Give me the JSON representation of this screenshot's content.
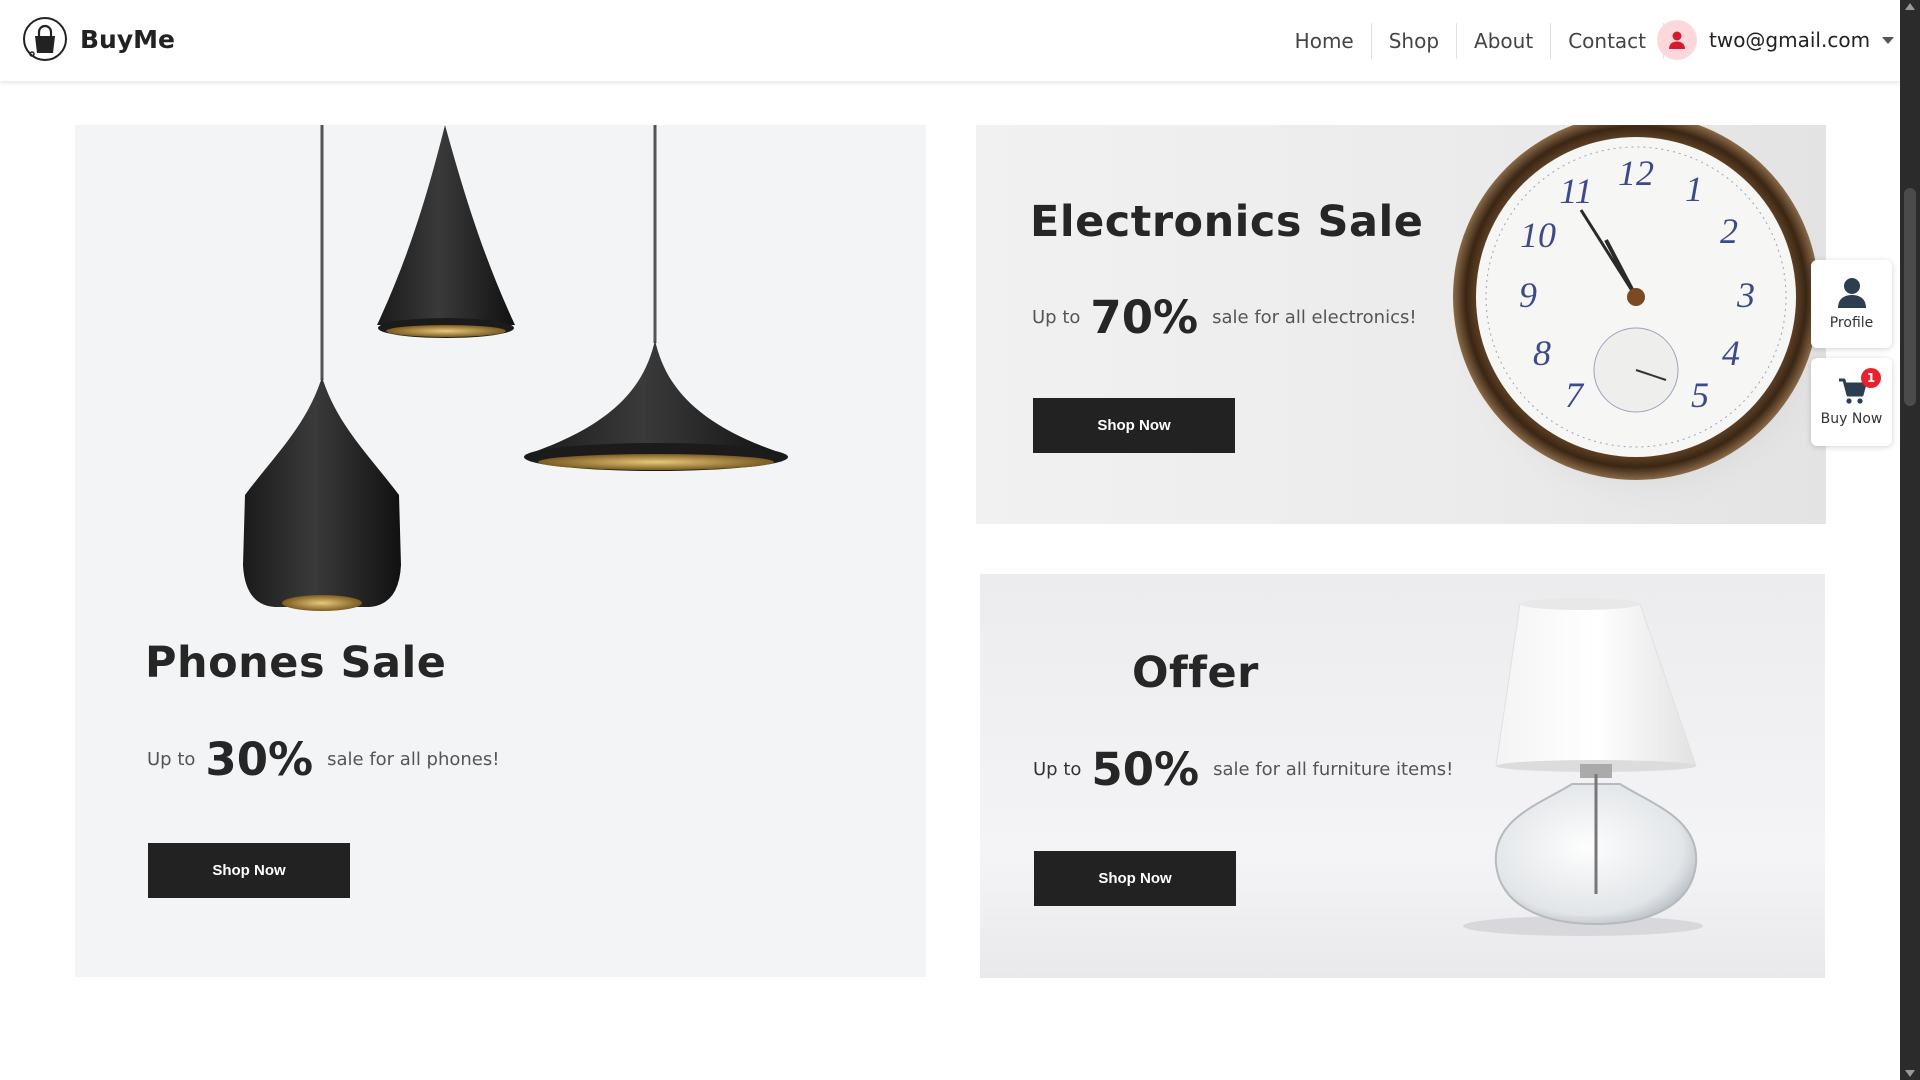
{
  "header": {
    "brand": "BuyMe",
    "nav": [
      "Home",
      "Shop",
      "About",
      "Contact"
    ],
    "user_email": "two@gmail.com"
  },
  "banners": {
    "phones": {
      "title": "Phones Sale",
      "upto": "Up to",
      "percent": "30%",
      "desc": "sale for all phones!",
      "button": "Shop Now"
    },
    "electronics": {
      "title": "Electronics Sale",
      "upto": "Up to",
      "percent": "70%",
      "desc": "sale for all electronics!",
      "button": "Shop Now"
    },
    "offer": {
      "title": "Offer",
      "upto": "Up to",
      "percent": "50%",
      "desc": "sale for all furniture items!",
      "button": "Shop Now"
    }
  },
  "side": {
    "profile_label": "Profile",
    "buy_label": "Buy Now",
    "cart_count": "1"
  },
  "icons": {
    "logo": "shopping-bag-icon",
    "avatar": "user-icon",
    "dropdown": "caret-down-icon",
    "profile": "user-icon",
    "cart": "cart-icon"
  },
  "colors": {
    "button_bg": "#222222",
    "badge": "#e8212e",
    "avatar_bg": "#fcd8dd",
    "avatar_icon": "#d81b2c"
  }
}
